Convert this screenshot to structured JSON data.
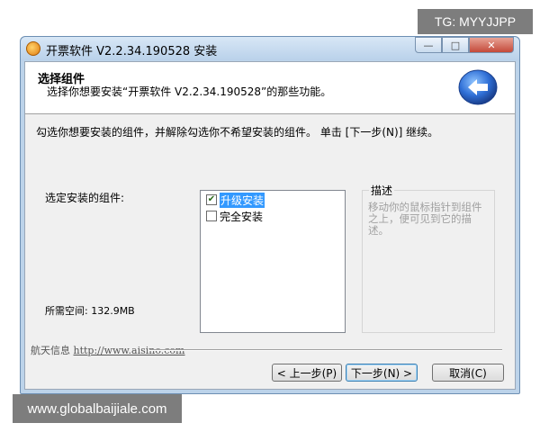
{
  "watermarks": {
    "top_right": "TG: MYYJJPP",
    "bottom_left": "www.globalbaijiale.com"
  },
  "window": {
    "title": "开票软件 V2.2.34.190528 安装",
    "controls": {
      "minimize": "—",
      "maximize": "□",
      "close": "✕"
    }
  },
  "header": {
    "title": "选择组件",
    "subtitle": "选择你想要安装“开票软件 V2.2.34.190528”的那些功能。"
  },
  "instruction": "勾选你想要安装的组件，并解除勾选你不希望安装的组件。 单击 [下一步(N)] 继续。",
  "components": {
    "label": "选定安装的组件:",
    "items": [
      {
        "label": "升级安装",
        "checked": true,
        "selected": true
      },
      {
        "label": "完全安装",
        "checked": false,
        "selected": false
      }
    ]
  },
  "description": {
    "legend": "描述",
    "text": "移动你的鼠标指针到组件之上，便可见到它的描述。"
  },
  "space_required": "所需空间: 132.9MB",
  "branding": {
    "company": "航天信息",
    "url": "http://www.aisino.com"
  },
  "buttons": {
    "back": "< 上一步(P)",
    "next": "下一步(N) >",
    "cancel": "取消(C)"
  },
  "colors": {
    "accent": "#3399ff",
    "check": "#2a6a1a"
  }
}
